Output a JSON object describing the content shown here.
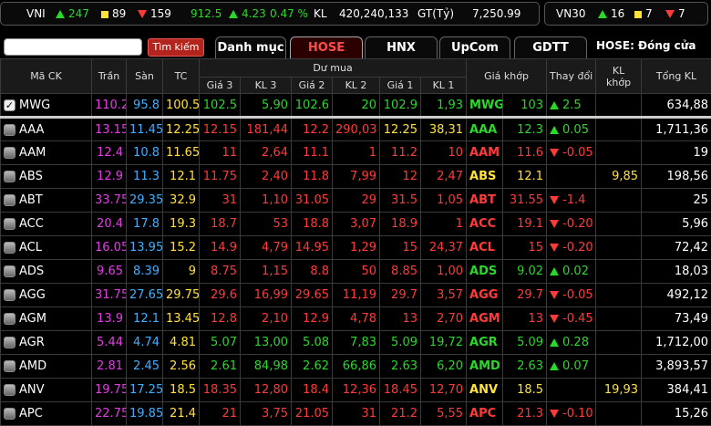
{
  "ticker_vni": {
    "name": "VNI",
    "up_count": "247",
    "ref_count": "89",
    "down_count": "159",
    "index": "912.5",
    "change": "4.23",
    "pct": "0.47 %",
    "kl_label": "KL",
    "kl_value": "420,240,133",
    "gt_label": "GT(Tỷ)",
    "gt_value": "7,250.99"
  },
  "ticker_vn30": {
    "name": "VN30",
    "up_count": "16",
    "ref_count": "7",
    "down_count": "7"
  },
  "toolbar": {
    "search_value": "",
    "search_button": "Tìm kiếm",
    "tabs": [
      "Danh mục",
      "HOSE",
      "HNX",
      "UpCom",
      "GDTT"
    ],
    "active_tab": "HOSE",
    "status": "HOSE:  Đóng cửa"
  },
  "headers": {
    "symbol": "Mã CK",
    "ceiling": "Trần",
    "floor": "Sàn",
    "ref": "TC",
    "bid_group": "Dư mua",
    "bid_cols": [
      "Giá 3",
      "KL 3",
      "Giá 2",
      "KL 2",
      "Giá 1",
      "KL 1"
    ],
    "match_price": "Giá khớp",
    "change": "Thay đổi",
    "match_vol": "KL khớp",
    "total_vol": "Tổng KL"
  },
  "colors": {
    "up": "#2ad82a",
    "ref": "#ffe23a",
    "down": "#ff3a3a",
    "ceiling": "#e040e0",
    "floor": "#3fb0ff"
  },
  "rows": [
    {
      "sym": "MWG",
      "checked": true,
      "tran": "110.2",
      "san": "95.8",
      "tc": "100.5",
      "g3": "102.5",
      "k3": "5,90",
      "g2": "102.6",
      "k2": "20",
      "g1": "102.9",
      "k1": "1,93",
      "mp": "103",
      "dir": "up",
      "chg": "2.5",
      "kl": "",
      "tot": "634,88"
    },
    {
      "sym": "AAA",
      "checked": false,
      "tran": "13.15",
      "san": "11.45",
      "tc": "12.25",
      "g3": "12.15",
      "k3": "181,44",
      "g2": "12.2",
      "k2": "290,03",
      "g1": "12.25",
      "k1": "38,31",
      "mp": "12.3",
      "dir": "up",
      "chg": "0.05",
      "kl": "",
      "tot": "1,711,36",
      "bidc": [
        "dn",
        "dn",
        "dn",
        "dn",
        "ref",
        "ref"
      ]
    },
    {
      "sym": "AAM",
      "checked": false,
      "tran": "12.4",
      "san": "10.8",
      "tc": "11.65",
      "g3": "11",
      "k3": "2,64",
      "g2": "11.1",
      "k2": "1",
      "g1": "11.2",
      "k1": "10",
      "mp": "11.6",
      "dir": "dn",
      "chg": "-0.05",
      "kl": "",
      "tot": "19"
    },
    {
      "sym": "ABS",
      "checked": false,
      "tran": "12.9",
      "san": "11.3",
      "tc": "12.1",
      "g3": "11.75",
      "k3": "2,40",
      "g2": "11.8",
      "k2": "7,99",
      "g1": "12",
      "k1": "2,47",
      "mp": "12.1",
      "dir": "ref",
      "chg": "",
      "kl": "9,85",
      "tot": "198,56"
    },
    {
      "sym": "ABT",
      "checked": false,
      "tran": "33.75",
      "san": "29.35",
      "tc": "32.9",
      "g3": "31",
      "k3": "1,10",
      "g2": "31.05",
      "k2": "29",
      "g1": "31.5",
      "k1": "1,05",
      "mp": "31.55",
      "dir": "dn",
      "chg": "-1.4",
      "kl": "",
      "tot": "25"
    },
    {
      "sym": "ACC",
      "checked": false,
      "tran": "20.4",
      "san": "17.8",
      "tc": "19.3",
      "g3": "18.7",
      "k3": "53",
      "g2": "18.8",
      "k2": "3,07",
      "g1": "18.9",
      "k1": "1",
      "mp": "19.1",
      "dir": "dn",
      "chg": "-0.20",
      "kl": "",
      "tot": "5,96"
    },
    {
      "sym": "ACL",
      "checked": false,
      "tran": "16.05",
      "san": "13.95",
      "tc": "15.2",
      "g3": "14.9",
      "k3": "4,79",
      "g2": "14.95",
      "k2": "1,29",
      "g1": "15",
      "k1": "24,37",
      "mp": "15",
      "dir": "dn",
      "chg": "-0.20",
      "kl": "",
      "tot": "72,42"
    },
    {
      "sym": "ADS",
      "checked": false,
      "tran": "9.65",
      "san": "8.39",
      "tc": "9",
      "g3": "8.75",
      "k3": "1,15",
      "g2": "8.8",
      "k2": "50",
      "g1": "8.85",
      "k1": "1,00",
      "mp": "9.02",
      "dir": "up",
      "chg": "0.02",
      "kl": "",
      "tot": "18,03"
    },
    {
      "sym": "AGG",
      "checked": false,
      "tran": "31.75",
      "san": "27.65",
      "tc": "29.75",
      "g3": "29.6",
      "k3": "16,99",
      "g2": "29.65",
      "k2": "11,19",
      "g1": "29.7",
      "k1": "3,57",
      "mp": "29.7",
      "dir": "dn",
      "chg": "-0.05",
      "kl": "",
      "tot": "492,12"
    },
    {
      "sym": "AGM",
      "checked": false,
      "tran": "13.9",
      "san": "12.1",
      "tc": "13.45",
      "g3": "12.8",
      "k3": "2,10",
      "g2": "12.9",
      "k2": "4,78",
      "g1": "13",
      "k1": "2,70",
      "mp": "13",
      "dir": "dn",
      "chg": "-0.45",
      "kl": "",
      "tot": "73,49"
    },
    {
      "sym": "AGR",
      "checked": false,
      "tran": "5.44",
      "san": "4.74",
      "tc": "4.81",
      "g3": "5.07",
      "k3": "13,00",
      "g2": "5.08",
      "k2": "7,83",
      "g1": "5.09",
      "k1": "19,72",
      "mp": "5.09",
      "dir": "up",
      "chg": "0.28",
      "kl": "",
      "tot": "1,712,00",
      "bidc": [
        "up",
        "up",
        "up",
        "up",
        "up",
        "up"
      ]
    },
    {
      "sym": "AMD",
      "checked": false,
      "tran": "2.81",
      "san": "2.45",
      "tc": "2.56",
      "g3": "2.61",
      "k3": "84,98",
      "g2": "2.62",
      "k2": "66,86",
      "g1": "2.63",
      "k1": "6,20",
      "mp": "2.63",
      "dir": "up",
      "chg": "0.07",
      "kl": "",
      "tot": "3,893,57",
      "bidc": [
        "up",
        "up",
        "up",
        "up",
        "up",
        "up"
      ]
    },
    {
      "sym": "ANV",
      "checked": false,
      "tran": "19.75",
      "san": "17.25",
      "tc": "18.5",
      "g3": "18.35",
      "k3": "12,80",
      "g2": "18.4",
      "k2": "12,36",
      "g1": "18.45",
      "k1": "12,70",
      "mp": "18.5",
      "dir": "ref",
      "chg": "",
      "kl": "19,93",
      "tot": "384,41"
    },
    {
      "sym": "APC",
      "checked": false,
      "tran": "22.75",
      "san": "19.85",
      "tc": "21.4",
      "g3": "21",
      "k3": "3,75",
      "g2": "21.05",
      "k2": "31",
      "g1": "21.2",
      "k1": "5,55",
      "mp": "21.3",
      "dir": "dn",
      "chg": "-0.10",
      "kl": "",
      "tot": "15,26"
    }
  ]
}
